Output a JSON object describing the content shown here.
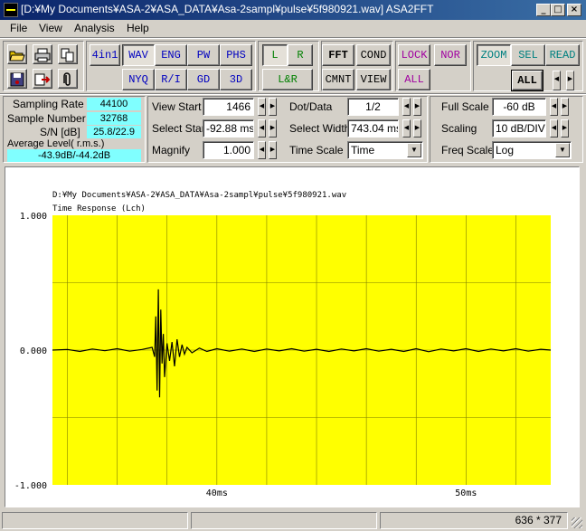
{
  "window": {
    "title": "[D:¥My Documents¥ASA-2¥ASA_DATA¥Asa-2sampl¥pulse¥5f980921.wav] ASA2FFT",
    "controls": [
      "_",
      "□",
      "×"
    ]
  },
  "menu": [
    "File",
    "View",
    "Analysis",
    "Help"
  ],
  "toolbar": {
    "mode_row1": [
      "4in1",
      "WAV",
      "ENG",
      "PW",
      "PHS"
    ],
    "mode_row2": [
      "NYQ",
      "R/I",
      "GD",
      "3D"
    ],
    "channel_row1": [
      "L",
      "R"
    ],
    "channel_row2": [
      "L&R"
    ],
    "fft_row1": [
      "FFT",
      "COND"
    ],
    "fft_row2": [
      "CMNT",
      "VIEW"
    ],
    "lock_row1": [
      "LOCK",
      "NOR"
    ],
    "lock_row2": [
      "ALL"
    ],
    "zoom_row1": [
      "ZOOM",
      "SEL",
      "READ"
    ],
    "zoom_all": "ALL",
    "colors": {
      "blue": "#0000c0",
      "green": "#008000",
      "purple": "#a000a0",
      "teal": "#008080"
    }
  },
  "info": {
    "sampling_rate_label": "Sampling Rate",
    "sampling_rate": "44100",
    "sample_number_label": "Sample Number",
    "sample_number": "32768",
    "sn_label": "S/N [dB]",
    "sn": "25.8/22.9",
    "avg_label": "Average Level( r.m.s.)",
    "avg": "-43.9dB/-44.2dB"
  },
  "view": {
    "view_start_label": "View Start",
    "view_start": "1466",
    "select_start_label": "Select Star",
    "select_start": "-92.88 ms",
    "magnify_label": "Magnify",
    "magnify": "1.000",
    "dot_data_label": "Dot/Data",
    "dot_data": "1/2",
    "select_width_label": "Select Width",
    "select_width": "743.04 ms",
    "time_scale_label": "Time Scale",
    "time_scale": "Time"
  },
  "scale": {
    "full_scale_label": "Full Scale",
    "full_scale": "-60 dB",
    "scaling_label": "Scaling",
    "scaling": "10 dB/DIV",
    "freq_scale_label": "Freq Scale",
    "freq_scale": "Log"
  },
  "chart_data": {
    "type": "line",
    "file_path": "D:¥My Documents¥ASA-2¥ASA_DATA¥Asa-2sampl¥pulse¥5f980921.wav",
    "title": "Time Response (Lch)",
    "y_ticks": [
      "1.000",
      "0.000",
      "-1.000"
    ],
    "x_ticks": [
      {
        "label": "40ms",
        "x": 40
      },
      {
        "label": "50ms",
        "x": 50
      }
    ],
    "xlim": [
      33.4,
      53.4
    ],
    "ylim": [
      -1,
      1
    ],
    "grid": true,
    "plot_bg": "#ffff00",
    "grid_color": "#808000",
    "series": [
      {
        "color": "#000000",
        "points": [
          [
            33.4,
            0.0
          ],
          [
            34.0,
            0.005
          ],
          [
            34.5,
            -0.01
          ],
          [
            35.0,
            0.008
          ],
          [
            35.5,
            -0.005
          ],
          [
            36.0,
            0.01
          ],
          [
            36.5,
            -0.008
          ],
          [
            37.0,
            0.005
          ],
          [
            37.4,
            0.02
          ],
          [
            37.5,
            -0.05
          ],
          [
            37.55,
            0.25
          ],
          [
            37.6,
            -0.3
          ],
          [
            37.65,
            0.45
          ],
          [
            37.7,
            -0.35
          ],
          [
            37.75,
            0.3
          ],
          [
            37.8,
            -0.1
          ],
          [
            37.85,
            0.12
          ],
          [
            37.9,
            -0.2
          ],
          [
            38.0,
            0.05
          ],
          [
            38.1,
            -0.08
          ],
          [
            38.2,
            0.06
          ],
          [
            38.3,
            -0.12
          ],
          [
            38.4,
            0.08
          ],
          [
            38.5,
            -0.05
          ],
          [
            38.6,
            0.04
          ],
          [
            38.7,
            -0.03
          ],
          [
            38.8,
            0.02
          ],
          [
            39.0,
            -0.02
          ],
          [
            39.3,
            0.015
          ],
          [
            39.6,
            -0.01
          ],
          [
            40.0,
            0.01
          ],
          [
            40.5,
            -0.008
          ],
          [
            41.0,
            0.008
          ],
          [
            41.5,
            -0.01
          ],
          [
            42.0,
            0.008
          ],
          [
            42.5,
            -0.006
          ],
          [
            43.0,
            0.01
          ],
          [
            43.5,
            -0.008
          ],
          [
            44.0,
            0.006
          ],
          [
            44.5,
            -0.01
          ],
          [
            45.0,
            0.008
          ],
          [
            45.5,
            -0.006
          ],
          [
            46.0,
            0.01
          ],
          [
            46.5,
            -0.008
          ],
          [
            47.0,
            0.006
          ],
          [
            47.5,
            -0.01
          ],
          [
            48.0,
            0.01
          ],
          [
            48.5,
            -0.012
          ],
          [
            49.0,
            0.008
          ],
          [
            49.5,
            -0.006
          ],
          [
            50.0,
            0.01
          ],
          [
            50.5,
            -0.01
          ],
          [
            51.0,
            0.008
          ],
          [
            51.5,
            -0.006
          ],
          [
            52.0,
            0.01
          ],
          [
            52.5,
            -0.008
          ],
          [
            53.0,
            0.006
          ],
          [
            53.4,
            0.0
          ]
        ]
      }
    ]
  },
  "status": {
    "coords": "636 * 377"
  }
}
